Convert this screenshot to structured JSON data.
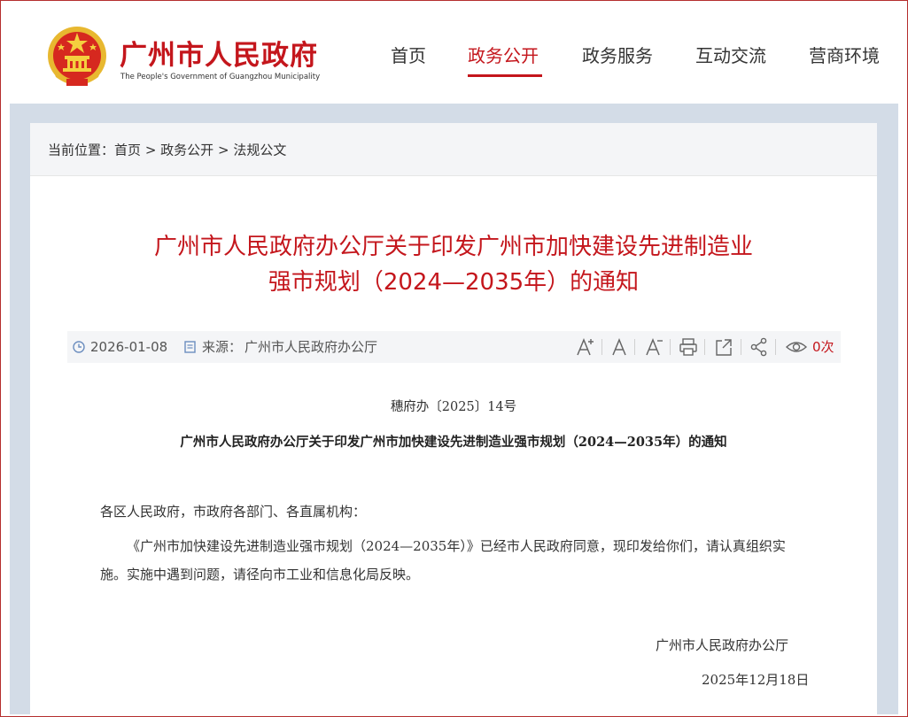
{
  "site": {
    "title": "广州市人民政府",
    "subtitle": "The People's Government of Guangzhou Municipality",
    "brand_color": "#c4161c"
  },
  "nav": [
    {
      "label": "首页",
      "active": false
    },
    {
      "label": "政务公开",
      "active": true
    },
    {
      "label": "政务服务",
      "active": false
    },
    {
      "label": "互动交流",
      "active": false
    },
    {
      "label": "营商环境",
      "active": false
    }
  ],
  "breadcrumb": {
    "prefix": "当前位置：",
    "items": [
      "首页",
      "政务公开",
      "法规公文"
    ],
    "separator": ">"
  },
  "article": {
    "title_line1": "广州市人民政府办公厅关于印发广州市加快建设先进制造业",
    "title_line2": "强市规划（2024—2035年）的通知",
    "date": "2026-01-08",
    "source_label": "来源：",
    "source": "广州市人民政府办公厅",
    "views": "0次",
    "tools": [
      "font-larger-icon",
      "font-reset-icon",
      "font-smaller-icon",
      "print-icon",
      "share-out-icon",
      "share-icon",
      "eye-icon"
    ]
  },
  "document": {
    "number": "穗府办〔2025〕14号",
    "heading": "广州市人民政府办公厅关于印发广州市加快建设先进制造业强市规划（2024—2035年）的通知",
    "salutation": "各区人民政府，市政府各部门、各直属机构：",
    "paragraph": "《广州市加快建设先进制造业强市规划（2024—2035年）》已经市人民政府同意，现印发给你们，请认真组织实施。实施中遇到问题，请径向市工业和信息化局反映。",
    "signature_org": "广州市人民政府办公厅",
    "signature_date": "2025年12月18日"
  }
}
